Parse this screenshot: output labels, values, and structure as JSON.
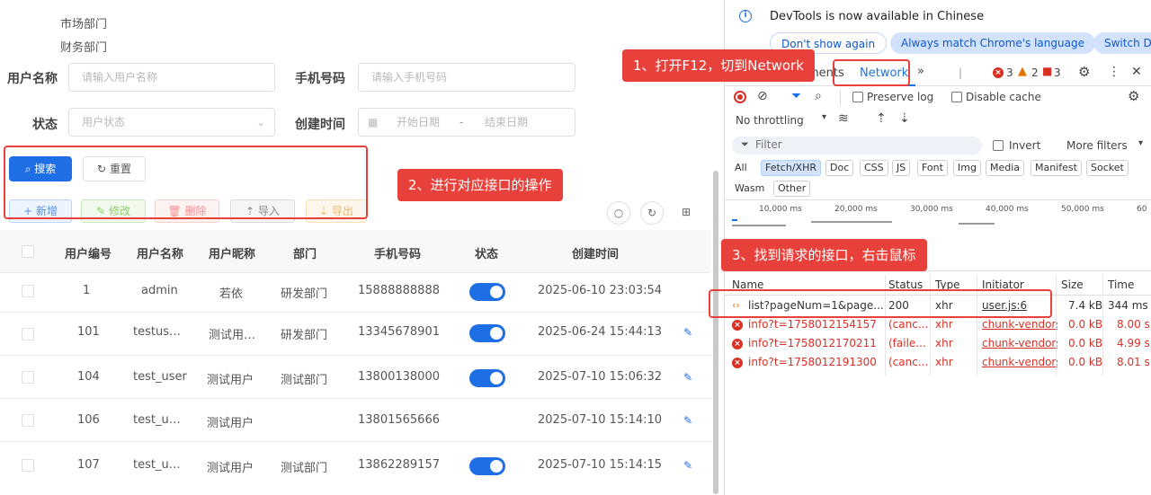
{
  "tree": [
    "市场部门",
    "财务部门"
  ],
  "search_form": {
    "username_label": "用户名称",
    "username_placeholder": "请输入用户名称",
    "phone_label": "手机号码",
    "phone_placeholder": "请输入手机号码",
    "status_label": "状态",
    "status_placeholder": "用户状态",
    "created_label": "创建时间",
    "start_placeholder": "开始日期",
    "range_sep": "-",
    "end_placeholder": "结束日期",
    "search_btn": "搜索",
    "reset_btn": "重置"
  },
  "toolbar": {
    "add": "新增",
    "edit": "修改",
    "delete": "删除",
    "import": "导入",
    "export": "导出"
  },
  "table": {
    "headers": [
      "用户编号",
      "用户名称",
      "用户昵称",
      "部门",
      "手机号码",
      "状态",
      "创建时间"
    ],
    "rows": [
      {
        "id": "1",
        "name": "admin",
        "nick": "若依",
        "dept": "研发部门",
        "phone": "15888888888",
        "created": "2025-06-10 23:03:54"
      },
      {
        "id": "101",
        "name": "testus…",
        "nick": "测试用…",
        "dept": "研发部门",
        "phone": "13345678901",
        "created": "2025-06-24 15:44:13"
      },
      {
        "id": "104",
        "name": "test_user",
        "nick": "测试用户",
        "dept": "测试部门",
        "phone": "13800138000",
        "created": "2025-07-10 15:06:32"
      },
      {
        "id": "106",
        "name": "test_u…",
        "nick": "测试用户",
        "dept": "",
        "phone": "13801565666",
        "created": "2025-07-10 15:14:10"
      },
      {
        "id": "107",
        "name": "test_u…",
        "nick": "测试用户",
        "dept": "测试部门",
        "phone": "13862289157",
        "created": "2025-07-10 15:14:15"
      }
    ]
  },
  "callouts": {
    "step1": "1、打开F12，切到Network",
    "step2": "2、进行对应接口的操作",
    "step3": "3、找到请求的接口，右击鼠标"
  },
  "devtools": {
    "banner_text": "DevTools is now available in Chinese",
    "dont_show": "Don't show again",
    "always_match": "Always match Chrome's language",
    "switch_d": "Switch D",
    "tab_elements_partial": "ments",
    "tab_network": "Network",
    "err_count": "3",
    "warn_count": "2",
    "issue_count": "3",
    "preserve_log": "Preserve log",
    "disable_cache": "Disable cache",
    "throttling": "No throttling",
    "filter_placeholder": "Filter",
    "invert": "Invert",
    "more_filters": "More filters",
    "filter_types": [
      "All",
      "Fetch/XHR",
      "Doc",
      "CSS",
      "JS",
      "Font",
      "Img",
      "Media",
      "Manifest",
      "Socket",
      "Wasm",
      "Other"
    ],
    "timeline_labels": [
      "10,000 ms",
      "20,000 ms",
      "30,000 ms",
      "40,000 ms",
      "50,000 ms",
      "60"
    ],
    "columns": [
      "Name",
      "Status",
      "Type",
      "Initiator",
      "Size",
      "Time"
    ],
    "requests": [
      {
        "name": "list?pageNum=1&page...",
        "status": "200",
        "type": "xhr",
        "initiator": "user.js:6",
        "size": "7.4 kB",
        "time": "344 ms",
        "error": false
      },
      {
        "name": "info?t=1758012154157",
        "status": "(canc...",
        "type": "xhr",
        "initiator": "chunk-vendors",
        "size": "0.0 kB",
        "time": "8.00 s",
        "error": true
      },
      {
        "name": "info?t=1758012170211",
        "status": "(faile...",
        "type": "xhr",
        "initiator": "chunk-vendors",
        "size": "0.0 kB",
        "time": "4.99 s",
        "error": true
      },
      {
        "name": "info?t=1758012191300",
        "status": "(canc...",
        "type": "xhr",
        "initiator": "chunk-vendors",
        "size": "0.0 kB",
        "time": "8.01 s",
        "error": true
      }
    ]
  },
  "colors": {
    "primary": "#1e6fe6",
    "callout": "#e8413b",
    "error": "#d93025"
  }
}
